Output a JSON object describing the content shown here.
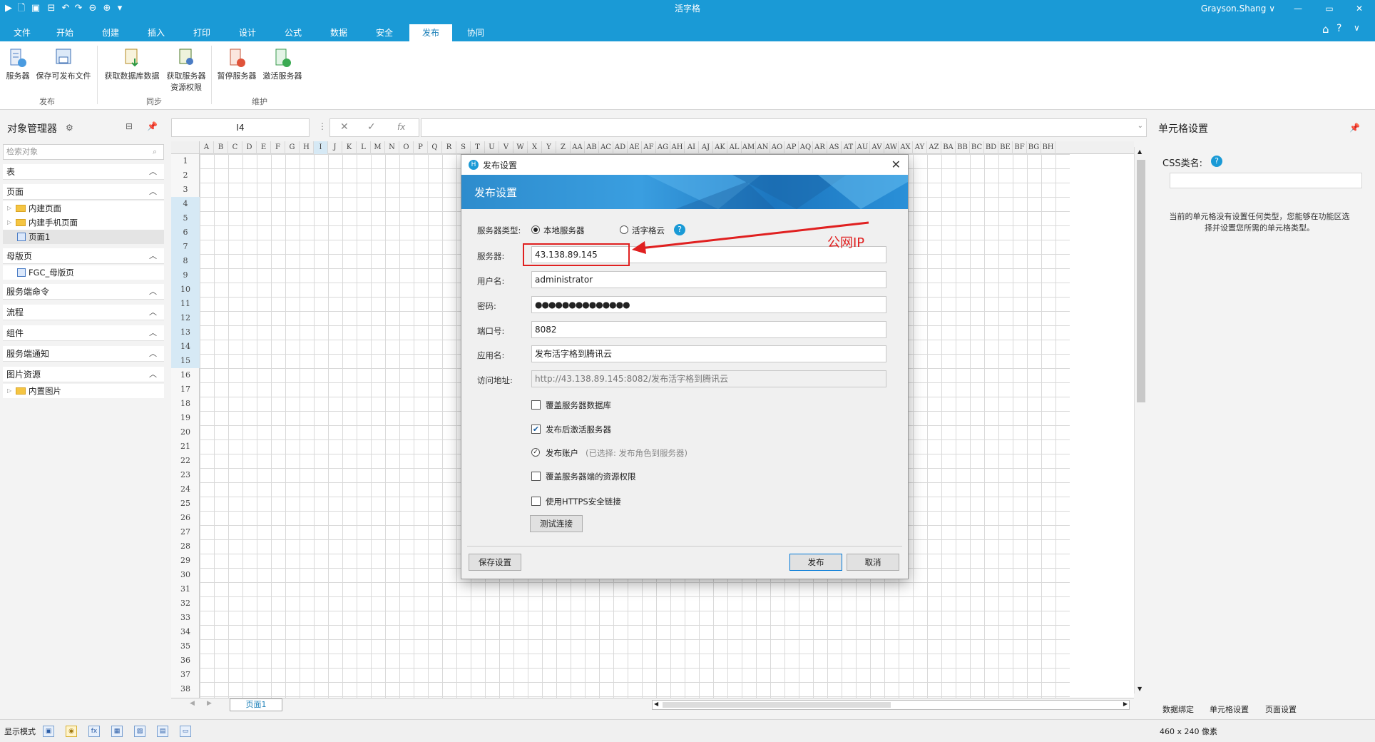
{
  "window": {
    "title": "活字格",
    "user": "Grayson.Shang ∨",
    "minimize": "—",
    "restore": "▭",
    "close": "✕"
  },
  "menu": {
    "tabs": [
      "文件",
      "开始",
      "创建",
      "插入",
      "打印",
      "设计",
      "公式",
      "数据",
      "安全",
      "发布",
      "协同"
    ],
    "active": "发布"
  },
  "ribbon": {
    "buttons": [
      "服务器",
      "保存可发布文件",
      "获取数据库数据",
      "获取服务器资源权限",
      "暂停服务器",
      "激活服务器"
    ],
    "groups": [
      "发布",
      "同步",
      "维护"
    ]
  },
  "left_panel": {
    "title": "对象管理器",
    "search_placeholder": "检索对象",
    "sections": {
      "tables": "表",
      "pages": "页面",
      "page_items": [
        "内建页面",
        "内建手机页面",
        "页面1"
      ],
      "master": "母版页",
      "master_items": [
        "FGC_母版页"
      ],
      "server_cmd": "服务端命令",
      "flow": "流程",
      "components": "组件",
      "server_notify": "服务端通知",
      "images": "图片资源",
      "image_items": [
        "内置图片"
      ]
    }
  },
  "formula_bar": {
    "cell_ref": "I4",
    "fx": "fx"
  },
  "grid": {
    "columns": [
      "A",
      "B",
      "C",
      "D",
      "E",
      "F",
      "G",
      "H",
      "I",
      "J",
      "K",
      "L",
      "M",
      "N",
      "O",
      "P",
      "Q",
      "R",
      "S",
      "T",
      "U",
      "V",
      "W",
      "X",
      "Y",
      "Z",
      "AA",
      "AB",
      "AC",
      "AD",
      "AE",
      "AF",
      "AG",
      "AH",
      "AI",
      "AJ",
      "AK",
      "AL",
      "AM",
      "AN",
      "AO",
      "AP",
      "AQ",
      "AR",
      "AS",
      "AT",
      "AU",
      "AV",
      "AW",
      "AX",
      "AY",
      "AZ",
      "BA",
      "BB",
      "BC",
      "BD",
      "BE",
      "BF",
      "BG",
      "BH"
    ],
    "rows": [
      "1",
      "2",
      "3",
      "4",
      "5",
      "6",
      "7",
      "8",
      "9",
      "10",
      "11",
      "12",
      "13",
      "14",
      "15",
      "16",
      "17",
      "18",
      "19",
      "20",
      "21",
      "22",
      "23",
      "24",
      "25",
      "26",
      "27",
      "28",
      "29",
      "30",
      "31",
      "32",
      "33",
      "34",
      "35",
      "36",
      "37",
      "38"
    ],
    "sheet_tab": "页面1"
  },
  "right_panel": {
    "title": "单元格设置",
    "css_label": "CSS类名:",
    "note": "当前的单元格没有设置任何类型，您能够在功能区选择并设置您所需的单元格类型。",
    "tabs": [
      "数据绑定",
      "单元格设置",
      "页面设置"
    ]
  },
  "status_bar": {
    "mode_label": "显示模式",
    "size": "460 x 240 像素"
  },
  "dialog": {
    "title": "发布设置",
    "banner": "发布设置",
    "server_type_label": "服务器类型:",
    "server_type_options": [
      "本地服务器",
      "活字格云"
    ],
    "server_type_selected": "本地服务器",
    "server_label": "服务器:",
    "server_value": "43.138.89.145",
    "user_label": "用户名:",
    "user_value": "administrator",
    "password_label": "密码:",
    "password_value": "●●●●●●●●●●●●●●",
    "port_label": "端口号:",
    "port_value": "8082",
    "app_label": "应用名:",
    "app_value": "发布活字格到腾讯云",
    "url_label": "访问地址:",
    "url_value": "http://43.138.89.145:8082/发布活字格到腾讯云",
    "options": {
      "overwrite_db": "覆盖服务器数据库",
      "overwrite_db_checked": false,
      "activate_after": "发布后激活服务器",
      "activate_after_checked": true,
      "publish_account": "发布账户",
      "publish_account_note": "(已选择: 发布角色到服务器)",
      "overwrite_perm": "覆盖服务器端的资源权限",
      "overwrite_perm_checked": false,
      "https": "使用HTTPS安全链接",
      "https_checked": false
    },
    "test_button": "测试连接",
    "save_button": "保存设置",
    "publish_button": "发布",
    "cancel_button": "取消"
  },
  "annotation": {
    "text": "公网IP",
    "color": "#e02020"
  },
  "colors": {
    "accent": "#1a9ad6",
    "annotation": "#e02020"
  }
}
